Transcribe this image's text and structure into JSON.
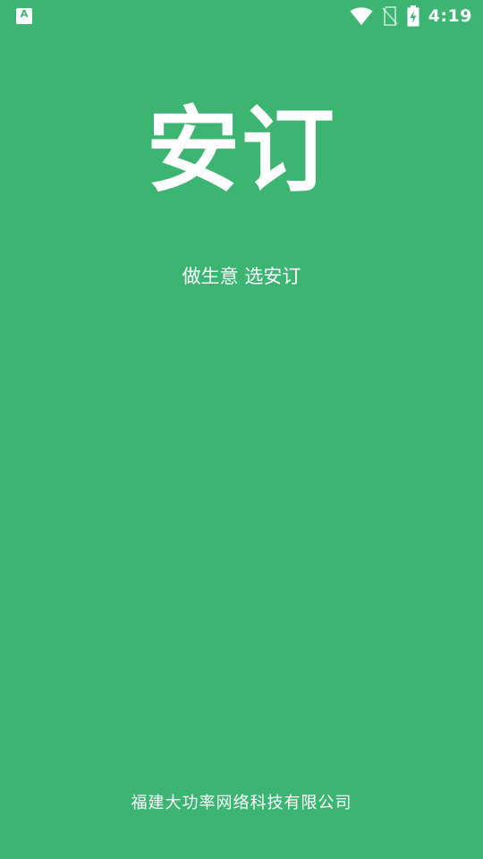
{
  "status_bar": {
    "time": "4:19",
    "notification_icon_letter": "A",
    "icons": [
      "app-notification-icon",
      "wifi-icon",
      "no-sim-icon",
      "battery-charging-icon"
    ]
  },
  "splash": {
    "title": "安订",
    "slogan": "做生意 选安订",
    "company": "福建大功率网络科技有限公司"
  },
  "colors": {
    "background": "#3db572",
    "foreground": "#ffffff"
  }
}
